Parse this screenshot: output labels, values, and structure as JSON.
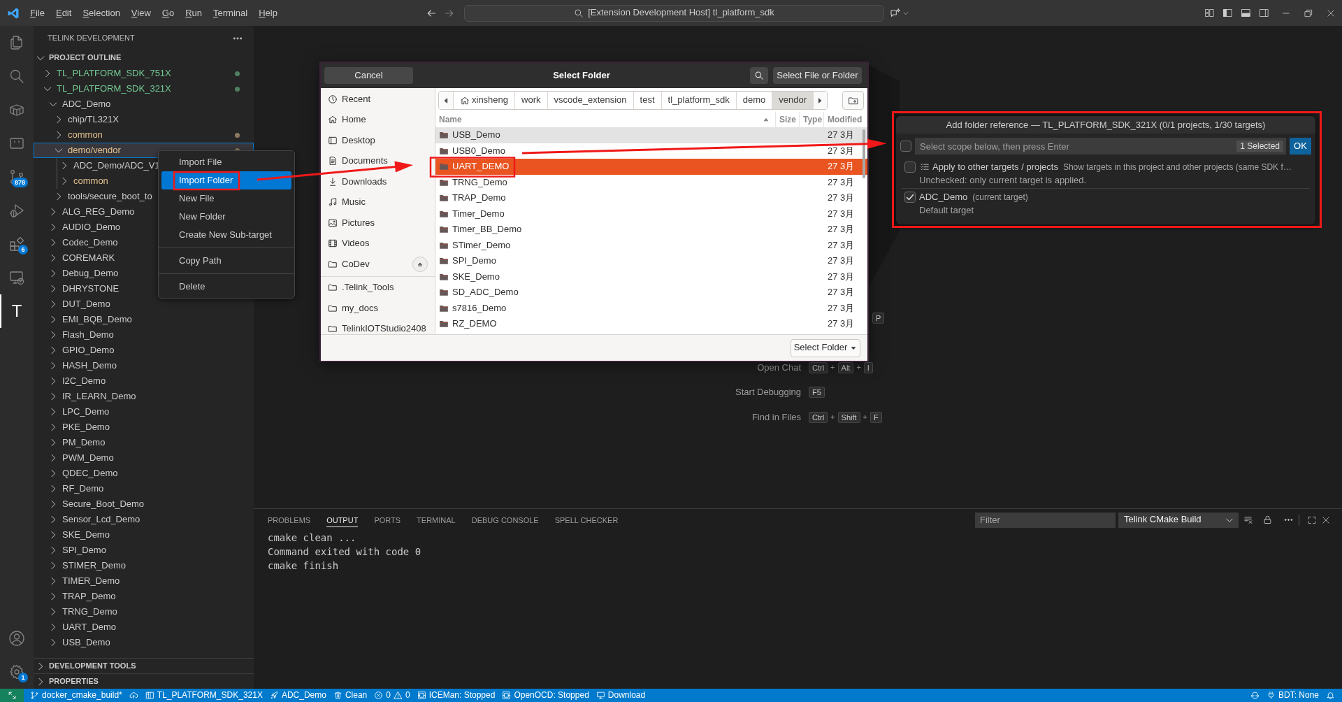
{
  "title_bar": {
    "menu": [
      "File",
      "Edit",
      "Selection",
      "View",
      "Go",
      "Run",
      "Terminal",
      "Help"
    ],
    "command_center": "[Extension Development Host] tl_platform_sdk"
  },
  "activity_bar": {
    "items": [
      {
        "kind": "files",
        "selected": false
      },
      {
        "kind": "search",
        "selected": false
      },
      {
        "kind": "box",
        "selected": false
      },
      {
        "kind": "device",
        "selected": false
      },
      {
        "kind": "source-control",
        "selected": false,
        "badge": "878"
      },
      {
        "kind": "run-debug",
        "selected": false
      },
      {
        "kind": "extensions",
        "selected": false,
        "badge": "6"
      },
      {
        "kind": "remote",
        "selected": false
      },
      {
        "kind": "letter",
        "glyph": "T",
        "selected": true
      }
    ],
    "bottom": [
      {
        "kind": "account"
      },
      {
        "kind": "settings",
        "badge": "1"
      }
    ]
  },
  "sidebar": {
    "title": "TELINK DEVELOPMENT",
    "sections": [
      {
        "title": "PROJECT OUTLINE",
        "expanded": true,
        "tree": [
          {
            "label": "TL_PLATFORM_SDK_751X",
            "expanded": false,
            "selected": false,
            "color": "#73c991",
            "dot": true
          },
          {
            "label": "TL_PLATFORM_SDK_321X",
            "expanded": true,
            "selected": false,
            "color": "#73c991",
            "dot": true,
            "children": [
              {
                "label": "ADC_Demo",
                "expanded": true,
                "selected": false,
                "children": [
                  {
                    "label": "chip/TL321X",
                    "expanded": false,
                    "selected": false
                  },
                  {
                    "label": "common",
                    "expanded": false,
                    "selected": false,
                    "color": "#e2c08d",
                    "dot": true
                  },
                  {
                    "label": "demo/vendor",
                    "expanded": true,
                    "selected": true,
                    "color": "#e2c08d",
                    "dot": true,
                    "children": [
                      {
                        "label": "ADC_Demo/ADC_V1",
                        "expanded": false,
                        "selected": false
                      },
                      {
                        "label": "common",
                        "expanded": false,
                        "selected": false,
                        "color": "#e2c08d"
                      }
                    ]
                  },
                  {
                    "label": "tools/secure_boot_to",
                    "expanded": false,
                    "selected": false
                  }
                ]
              },
              {
                "label": "ALG_REG_Demo",
                "expanded": false,
                "selected": false
              },
              {
                "label": "AUDIO_Demo",
                "expanded": false,
                "selected": false
              },
              {
                "label": "Codec_Demo",
                "expanded": false,
                "selected": false
              },
              {
                "label": "COREMARK",
                "expanded": false,
                "selected": false
              },
              {
                "label": "Debug_Demo",
                "expanded": false,
                "selected": false
              },
              {
                "label": "DHRYSTONE",
                "expanded": false,
                "selected": false
              },
              {
                "label": "DUT_Demo",
                "expanded": false,
                "selected": false
              },
              {
                "label": "EMI_BQB_Demo",
                "expanded": false,
                "selected": false
              },
              {
                "label": "Flash_Demo",
                "expanded": false,
                "selected": false
              },
              {
                "label": "GPIO_Demo",
                "expanded": false,
                "selected": false
              },
              {
                "label": "HASH_Demo",
                "expanded": false,
                "selected": false
              },
              {
                "label": "I2C_Demo",
                "expanded": false,
                "selected": false
              },
              {
                "label": "IR_LEARN_Demo",
                "expanded": false,
                "selected": false
              },
              {
                "label": "LPC_Demo",
                "expanded": false,
                "selected": false
              },
              {
                "label": "PKE_Demo",
                "expanded": false,
                "selected": false
              },
              {
                "label": "PM_Demo",
                "expanded": false,
                "selected": false
              },
              {
                "label": "PWM_Demo",
                "expanded": false,
                "selected": false
              },
              {
                "label": "QDEC_Demo",
                "expanded": false,
                "selected": false
              },
              {
                "label": "RF_Demo",
                "expanded": false,
                "selected": false
              },
              {
                "label": "Secure_Boot_Demo",
                "expanded": false,
                "selected": false
              },
              {
                "label": "Sensor_Lcd_Demo",
                "expanded": false,
                "selected": false
              },
              {
                "label": "SKE_Demo",
                "expanded": false,
                "selected": false
              },
              {
                "label": "SPI_Demo",
                "expanded": false,
                "selected": false
              },
              {
                "label": "STIMER_Demo",
                "expanded": false,
                "selected": false
              },
              {
                "label": "TIMER_Demo",
                "expanded": false,
                "selected": false
              },
              {
                "label": "TRAP_Demo",
                "expanded": false,
                "selected": false
              },
              {
                "label": "TRNG_Demo",
                "expanded": false,
                "selected": false
              },
              {
                "label": "UART_Demo",
                "expanded": false,
                "selected": false
              },
              {
                "label": "USB_Demo",
                "expanded": false,
                "selected": false
              }
            ]
          }
        ]
      },
      {
        "title": "DEVELOPMENT TOOLS",
        "expanded": false
      },
      {
        "title": "PROPERTIES",
        "expanded": false
      }
    ]
  },
  "context_menu": {
    "groups": [
      [
        {
          "label": "Import File",
          "selected": false
        },
        {
          "label": "Import Folder",
          "selected": true
        },
        {
          "label": "New File",
          "selected": false
        },
        {
          "label": "New Folder",
          "selected": false
        },
        {
          "label": "Create New Sub-target",
          "selected": false
        }
      ],
      [
        {
          "label": "Copy Path",
          "selected": false
        }
      ],
      [
        {
          "label": "Delete",
          "selected": false
        }
      ]
    ]
  },
  "folder_dialog": {
    "cancel": "Cancel",
    "title": "Select Folder",
    "accept": "Select File or Folder",
    "places": [
      {
        "kind": "recent",
        "label": "Recent"
      },
      {
        "kind": "home",
        "label": "Home"
      },
      {
        "kind": "desktop",
        "label": "Desktop"
      },
      {
        "kind": "documents",
        "label": "Documents"
      },
      {
        "kind": "downloads",
        "label": "Downloads"
      },
      {
        "kind": "music",
        "label": "Music"
      },
      {
        "kind": "pictures",
        "label": "Pictures"
      },
      {
        "kind": "videos",
        "label": "Videos"
      },
      {
        "kind": "drive",
        "label": "CoDev"
      }
    ],
    "bookmarks": [
      ".Telink_Tools",
      "my_docs",
      "TelinkIOTStudio2408"
    ],
    "path": [
      {
        "kind": "home",
        "label": "xinsheng",
        "selected": false
      },
      {
        "kind": "folder",
        "label": "work",
        "selected": false
      },
      {
        "kind": "folder",
        "label": "vscode_extension",
        "selected": false
      },
      {
        "kind": "folder",
        "label": "test",
        "selected": false
      },
      {
        "kind": "folder",
        "label": "tl_platform_sdk",
        "selected": false
      },
      {
        "kind": "folder",
        "label": "demo",
        "selected": false
      },
      {
        "kind": "folder",
        "label": "vendor",
        "selected": true
      }
    ],
    "columns": [
      "Name",
      "Size",
      "Type",
      "Modified"
    ],
    "rows": [
      {
        "name": "USB_Demo",
        "modified": "27 3月",
        "selected": false,
        "hovered": true
      },
      {
        "name": "USB0_Demo",
        "modified": "27 3月",
        "selected": false,
        "hovered": false
      },
      {
        "name": "UART_DEMO",
        "modified": "27 3月",
        "selected": true,
        "hovered": false
      },
      {
        "name": "TRNG_Demo",
        "modified": "27 3月",
        "selected": false,
        "hovered": false
      },
      {
        "name": "TRAP_Demo",
        "modified": "27 3月",
        "selected": false,
        "hovered": false
      },
      {
        "name": "Timer_Demo",
        "modified": "27 3月",
        "selected": false,
        "hovered": false
      },
      {
        "name": "Timer_BB_Demo",
        "modified": "27 3月",
        "selected": false,
        "hovered": false
      },
      {
        "name": "STimer_Demo",
        "modified": "27 3月",
        "selected": false,
        "hovered": false
      },
      {
        "name": "SPI_Demo",
        "modified": "27 3月",
        "selected": false,
        "hovered": false
      },
      {
        "name": "SKE_Demo",
        "modified": "27 3月",
        "selected": false,
        "hovered": false
      },
      {
        "name": "SD_ADC_Demo",
        "modified": "27 3月",
        "selected": false,
        "hovered": false
      },
      {
        "name": "s7816_Demo",
        "modified": "27 3月",
        "selected": false,
        "hovered": false
      },
      {
        "name": "RZ_DEMO",
        "modified": "27 3月",
        "selected": false,
        "hovered": false
      }
    ],
    "filter": "Select Folder"
  },
  "quick_pick": {
    "title": "Add folder reference — TL_PLATFORM_SDK_321X (0/1 projects, 1/30 targets)",
    "all_checked": false,
    "placeholder": "Select scope below, then press Enter",
    "count": "1 Selected",
    "ok": "OK",
    "items": [
      {
        "kind": "option",
        "label": "Apply to other targets / projects",
        "description": "Show targets in this project and other projects (same SDK f…",
        "detail": "Unchecked: only current target is applied.",
        "checked": false
      },
      {
        "kind": "target",
        "label": "ADC_Demo",
        "description": "(current target)",
        "detail": "Default target",
        "checked": true
      }
    ]
  },
  "editor_hints": {
    "covered_key": "P",
    "joiner": "+",
    "rows": [
      {
        "label": "Open Chat",
        "keys": [
          "Ctrl",
          "Alt",
          "I"
        ]
      },
      {
        "label": "Start Debugging",
        "keys": [
          "F5"
        ]
      },
      {
        "label": "Find in Files",
        "keys": [
          "Ctrl",
          "Shift",
          "F"
        ]
      }
    ]
  },
  "panel": {
    "tabs": [
      {
        "label": "PROBLEMS",
        "selected": false
      },
      {
        "label": "OUTPUT",
        "selected": true
      },
      {
        "label": "PORTS",
        "selected": false
      },
      {
        "label": "TERMINAL",
        "selected": false
      },
      {
        "label": "DEBUG CONSOLE",
        "selected": false
      },
      {
        "label": "SPELL CHECKER",
        "selected": false
      }
    ],
    "filter_placeholder": "Filter",
    "channel": "Telink CMake Build",
    "output": [
      "cmake clean ...",
      "Command exited with code 0",
      "cmake finish"
    ]
  },
  "status_bar": {
    "left": [
      {
        "kind": "branch",
        "text": "docker_cmake_build*"
      },
      {
        "kind": "sync"
      },
      {
        "kind": "project",
        "text": "TL_PLATFORM_SDK_321X"
      },
      {
        "kind": "target",
        "text": "ADC_Demo"
      },
      {
        "kind": "clean",
        "text": "Clean"
      },
      {
        "kind": "problems",
        "errors": "0",
        "warnings": "0"
      },
      {
        "kind": "tool",
        "text": "ICEMan: Stopped"
      },
      {
        "kind": "tool",
        "text": "OpenOCD: Stopped"
      },
      {
        "kind": "download",
        "text": "Download"
      }
    ],
    "right": [
      {
        "kind": "assistant"
      },
      {
        "kind": "debugger",
        "text": "BDT: None"
      },
      {
        "kind": "notifications"
      }
    ]
  }
}
